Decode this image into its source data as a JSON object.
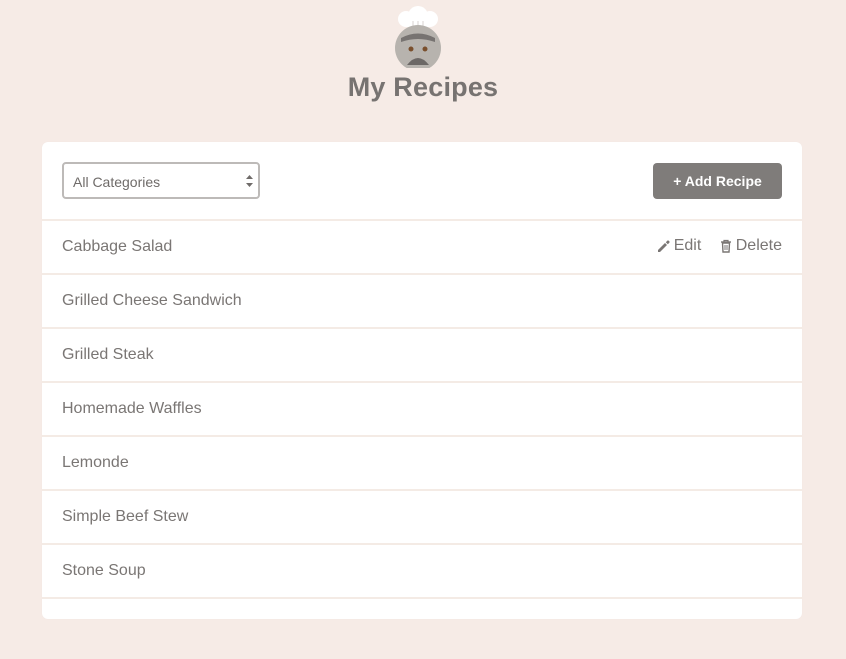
{
  "page": {
    "title": "My Recipes"
  },
  "filters": {
    "category_select_value": "All Categories"
  },
  "toolbar": {
    "add_label": "+ Add Recipe"
  },
  "recipes": [
    {
      "name": "Cabbage Salad"
    },
    {
      "name": "Grilled Cheese Sandwich"
    },
    {
      "name": "Grilled Steak"
    },
    {
      "name": "Homemade Waffles"
    },
    {
      "name": "Lemonde"
    },
    {
      "name": "Simple Beef Stew"
    },
    {
      "name": "Stone Soup"
    }
  ],
  "row_actions": {
    "edit_label": "Edit",
    "delete_label": "Delete"
  },
  "icons": {
    "logo": "chef-logo-icon",
    "edit": "pencil-icon",
    "delete": "trash-icon",
    "select": "select-arrows-icon"
  },
  "colors": {
    "background": "#f6ebe6",
    "panel": "#ffffff",
    "button": "#7f7c7a",
    "text": "#7a7674",
    "divider": "#f4ebe5"
  }
}
